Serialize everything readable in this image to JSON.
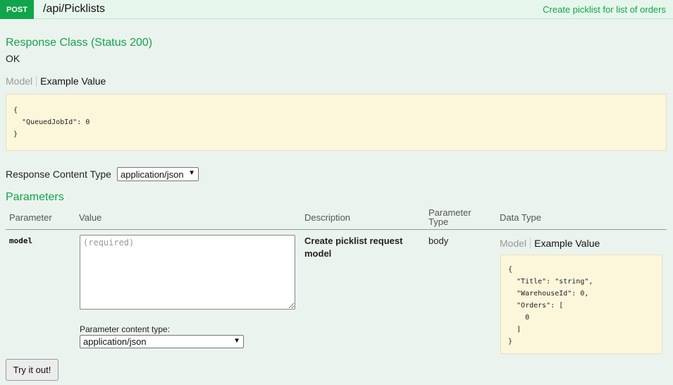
{
  "header": {
    "method": "POST",
    "path": "/api/Picklists",
    "summary": "Create picklist for list of orders"
  },
  "response_class": {
    "title": "Response Class (Status 200)",
    "status_text": "OK",
    "tab_model": "Model",
    "tab_example": "Example Value",
    "example_json": "{\n  \"QueuedJobId\": 0\n}"
  },
  "response_content_type": {
    "label": "Response Content Type",
    "selected": "application/json"
  },
  "parameters": {
    "title": "Parameters",
    "columns": [
      "Parameter",
      "Value",
      "Description",
      "Parameter Type",
      "Data Type"
    ],
    "rows": [
      {
        "name": "model",
        "placeholder": "(required)",
        "description": "Create picklist request model",
        "param_type": "body",
        "tab_model": "Model",
        "tab_example": "Example Value",
        "example_json": "{\n  \"Title\": \"string\",\n  \"WarehouseId\": 0,\n  \"Orders\": [\n    0\n  ]\n}",
        "content_type_label": "Parameter content type:",
        "content_type_selected": "application/json"
      }
    ]
  },
  "try_button": "Try it out!"
}
